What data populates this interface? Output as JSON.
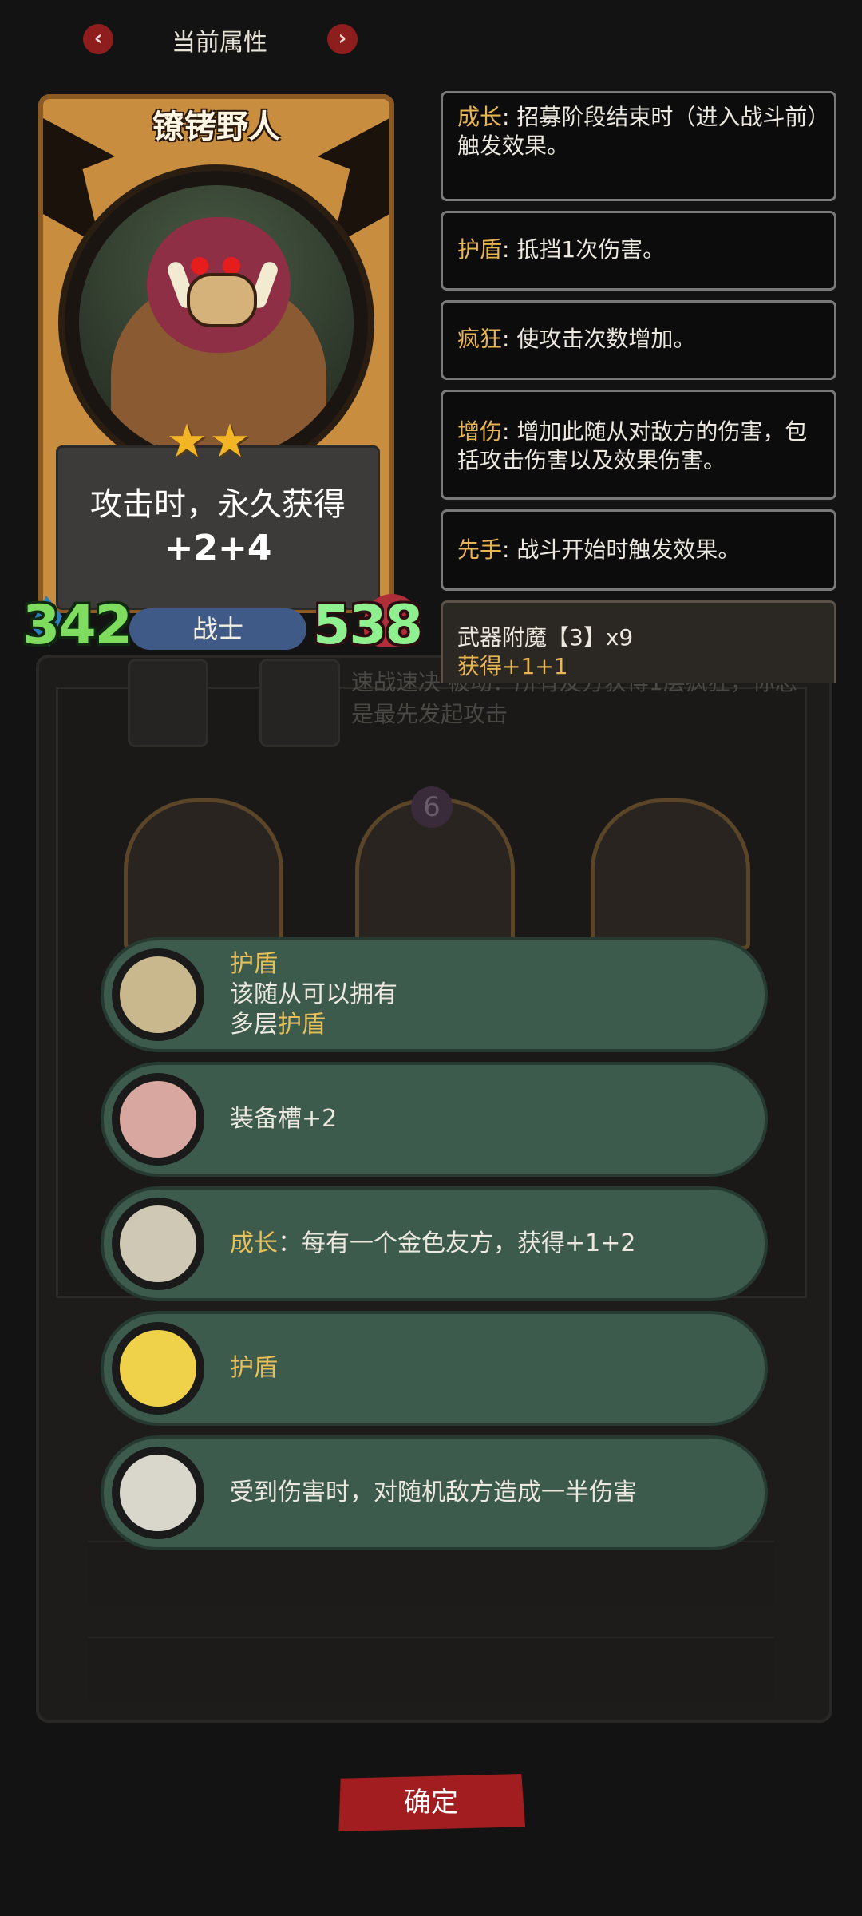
{
  "header": {
    "title": "当前属性",
    "prev_icon": "chevron-left-icon",
    "next_icon": "chevron-right-icon",
    "arrow_color": "#8e1d1d",
    "prev_glyph": "‹",
    "next_glyph": "›"
  },
  "card": {
    "name": "镣铐野人",
    "stars": 2,
    "star_glyph": "★",
    "description": "攻击时，永久获得",
    "description_value": "+2+4",
    "attack": "342",
    "health": "538",
    "class": "战士"
  },
  "keywords": [
    {
      "name": "成长",
      "sep": ": ",
      "text": "招募阶段结束时（进入战斗前）触发效果。"
    },
    {
      "name": "护盾",
      "sep": ": ",
      "text": "抵挡1次伤害。"
    },
    {
      "name": "疯狂",
      "sep": ": ",
      "text": "使攻击次数增加。"
    },
    {
      "name": "增伤",
      "sep": ": ",
      "text": "增加此随从对敌方的伤害，包括攻击伤害以及效果伤害。"
    },
    {
      "name": "先手",
      "sep": ": ",
      "text": "战斗开始时触发效果。"
    }
  ],
  "enchant": {
    "title": "武器附魔【3】x9",
    "bonus": "获得+1+1"
  },
  "background": {
    "text": "速战速决 被动：所有友方获得1层疯狂，你总是最先发起攻击",
    "badge": "6"
  },
  "perks": [
    {
      "icon": "mirror-icon",
      "gold_prefix": "护盾",
      "line1": "该随从可以拥有",
      "line2_plain": "多层",
      "line2_gold": "护盾"
    },
    {
      "icon": "pig-icon",
      "text": "装备槽+2"
    },
    {
      "icon": "dagger-icon",
      "gold_prefix": "成长",
      "text": "：每有一个金色友方，获得+1+2"
    },
    {
      "icon": "sun-warrior-icon",
      "gold_prefix": "护盾"
    },
    {
      "icon": "hand-mirror-icon",
      "text": "受到伤害时，对随机敌方造成一半伤害"
    }
  ],
  "confirm": {
    "label": "确定"
  },
  "colors": {
    "pill": "#3c5b4d",
    "gold_text": "#e8c05a",
    "confirm": "#a11d1f",
    "attack": "#7edc5e",
    "health": "#8ef08e"
  }
}
